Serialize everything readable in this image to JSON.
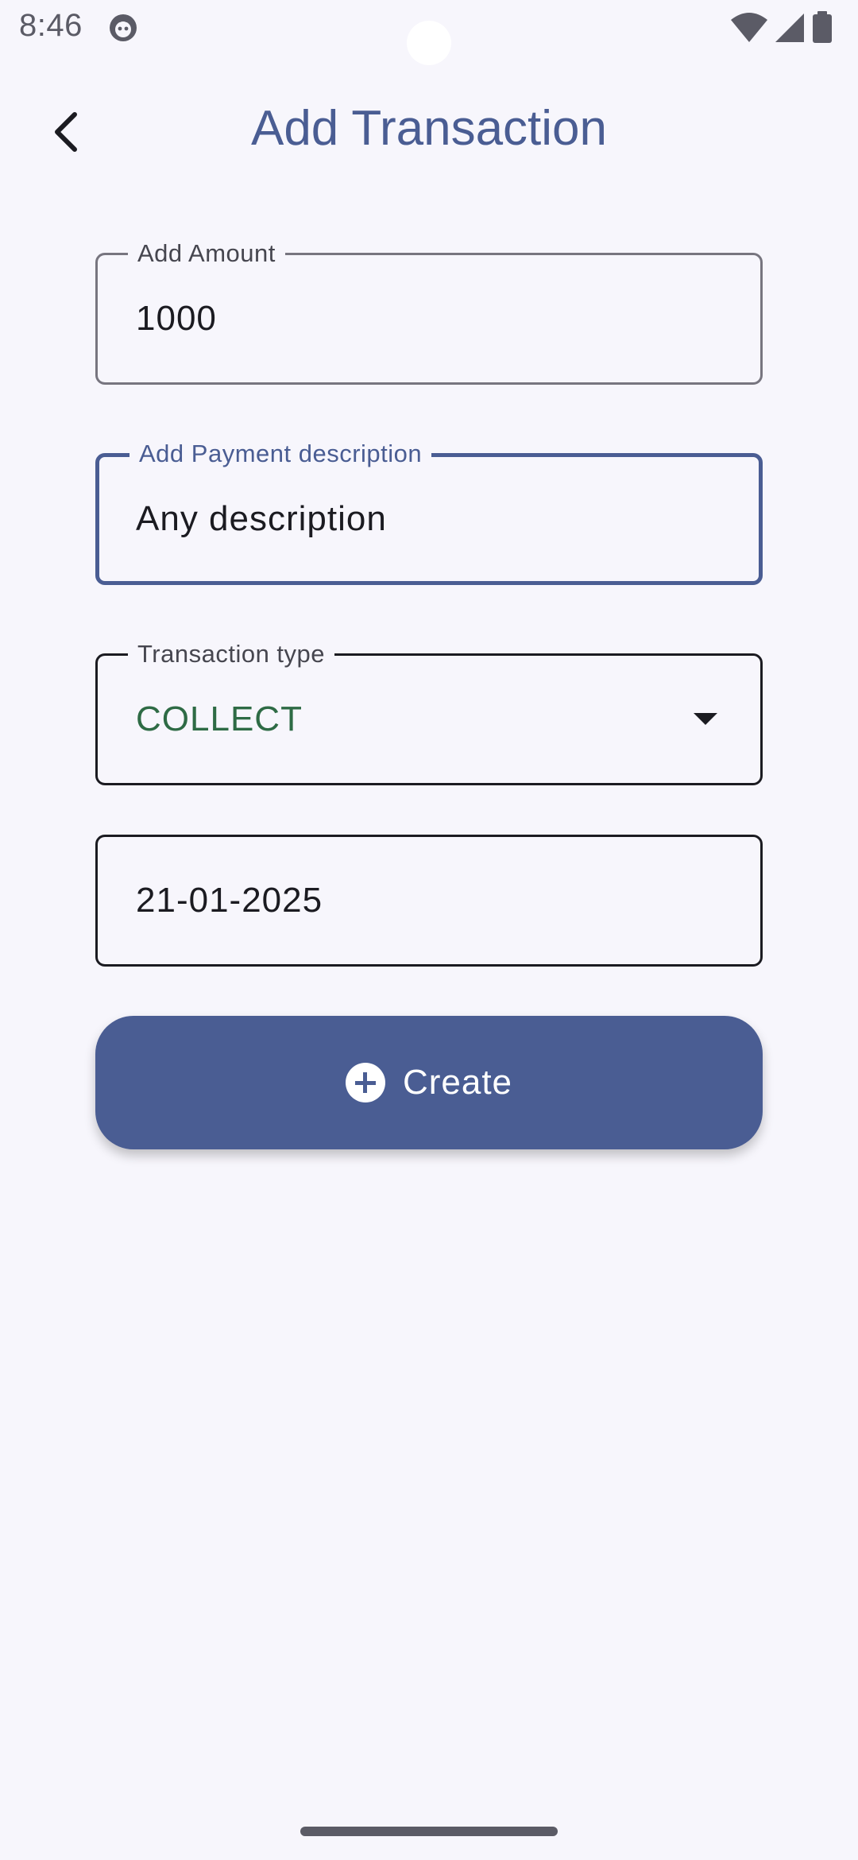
{
  "status_bar": {
    "time": "8:46",
    "icons": [
      "app-notification-icon",
      "wifi-icon",
      "signal-icon",
      "battery-icon"
    ]
  },
  "header": {
    "title": "Add Transaction",
    "back_icon": "chevron-left-icon"
  },
  "form": {
    "amount": {
      "label": "Add Amount",
      "value": "1000"
    },
    "description": {
      "label": "Add Payment description",
      "value": "Any description"
    },
    "transaction_type": {
      "label": "Transaction type",
      "value": "COLLECT"
    },
    "date": {
      "value": "21-01-2025"
    },
    "create_button": {
      "label": "Create",
      "icon": "add-circle-icon"
    }
  },
  "colors": {
    "primary": "#4a5d93",
    "background": "#f7f6fc",
    "success_text": "#2e6b45",
    "on_surface": "#1b1b21"
  }
}
